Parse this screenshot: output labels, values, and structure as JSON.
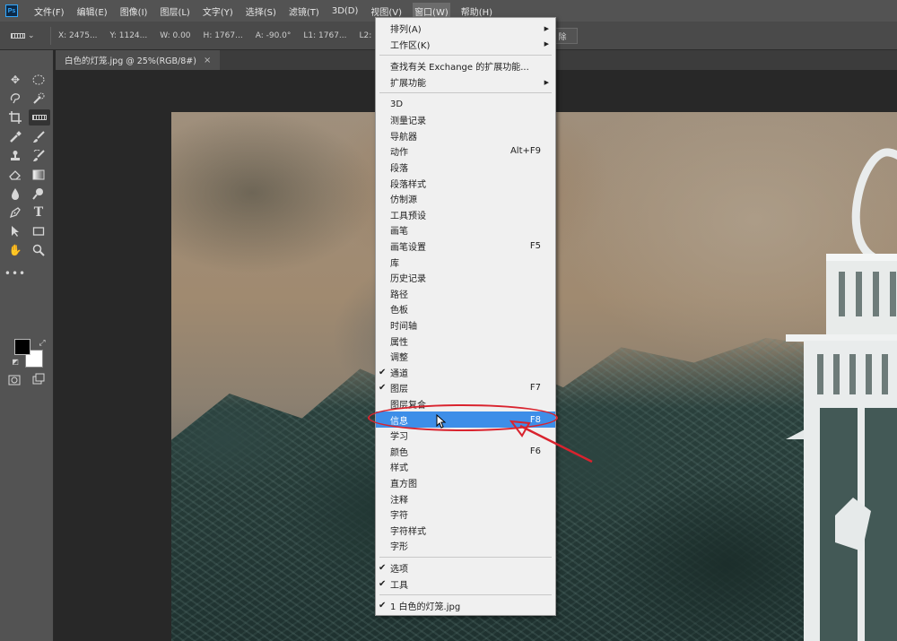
{
  "app": {
    "logo": "Ps"
  },
  "menubar": {
    "items": [
      "文件(F)",
      "编辑(E)",
      "图像(I)",
      "图层(L)",
      "文字(Y)",
      "选择(S)",
      "滤镜(T)",
      "3D(D)",
      "视图(V)",
      "窗口(W)",
      "帮助(H)"
    ],
    "active_index": 9
  },
  "options_bar": {
    "x": "X: 2475...",
    "y": "Y: 1124...",
    "w": "W: 0.00",
    "h": "H: 1767...",
    "a": "A: -90.0°",
    "l1": "L1: 1767...",
    "l2": "L2:",
    "right_button": "除"
  },
  "document_tab": {
    "title": "白色的灯笼.jpg @ 25%(RGB/8#)",
    "close": "×"
  },
  "window_menu": {
    "items": [
      {
        "label": "排列(A)",
        "submenu": true
      },
      {
        "label": "工作区(K)",
        "submenu": true
      },
      {
        "separator": true
      },
      {
        "label": "查找有关 Exchange 的扩展功能..."
      },
      {
        "label": "扩展功能",
        "submenu": true
      },
      {
        "separator": true
      },
      {
        "label": "3D"
      },
      {
        "label": "测量记录"
      },
      {
        "label": "导航器"
      },
      {
        "label": "动作",
        "shortcut": "Alt+F9"
      },
      {
        "label": "段落"
      },
      {
        "label": "段落样式"
      },
      {
        "label": "仿制源"
      },
      {
        "label": "工具预设"
      },
      {
        "label": "画笔"
      },
      {
        "label": "画笔设置",
        "shortcut": "F5"
      },
      {
        "label": "库"
      },
      {
        "label": "历史记录"
      },
      {
        "label": "路径"
      },
      {
        "label": "色板"
      },
      {
        "label": "时间轴"
      },
      {
        "label": "属性"
      },
      {
        "label": "调整"
      },
      {
        "label": "通道",
        "checked": true
      },
      {
        "label": "图层",
        "shortcut": "F7",
        "checked": true
      },
      {
        "label": "图层复合"
      },
      {
        "label": "信息",
        "shortcut": "F8",
        "highlighted": true
      },
      {
        "label": "学习"
      },
      {
        "label": "颜色",
        "shortcut": "F6"
      },
      {
        "label": "样式"
      },
      {
        "label": "直方图"
      },
      {
        "label": "注释"
      },
      {
        "label": "字符"
      },
      {
        "label": "字符样式"
      },
      {
        "label": "字形"
      },
      {
        "separator": true
      },
      {
        "label": "选项",
        "checked": true
      },
      {
        "label": "工具",
        "checked": true
      },
      {
        "separator": true
      },
      {
        "label": "1 白色的灯笼.jpg",
        "checked": true
      }
    ]
  },
  "colors": {
    "menubar": "#535353",
    "highlight": "#3d8ee8",
    "annotation": "#d9232e"
  }
}
